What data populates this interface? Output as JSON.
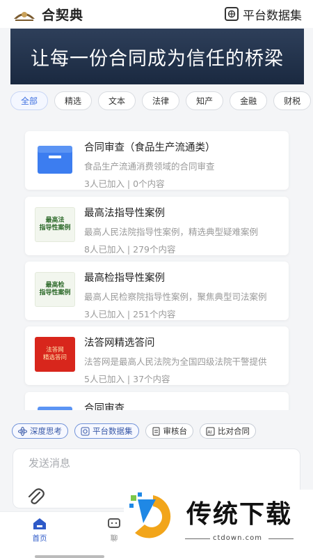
{
  "header": {
    "app_name": "合契典",
    "dataset_label": "平台数据集"
  },
  "banner": {
    "text": "让每一份合同成为信任的桥梁"
  },
  "categories": [
    {
      "label": "全部",
      "active": true
    },
    {
      "label": "精选"
    },
    {
      "label": "文本"
    },
    {
      "label": "法律"
    },
    {
      "label": "知产"
    },
    {
      "label": "金融"
    },
    {
      "label": "财税"
    }
  ],
  "cards": [
    {
      "title": "合同审查（食品生产流通类）",
      "desc": "食品生产流通消费领域的合同审查",
      "meta": "3人已加入 | 0个内容",
      "thumb": "folder-icon"
    },
    {
      "title": "最高法指导性案例",
      "desc": "最高人民法院指导性案例，精选典型疑难案例",
      "meta": "8人已加入 | 279个内容",
      "thumb_text": [
        "最高法",
        "指导性案例"
      ]
    },
    {
      "title": "最高检指导性案例",
      "desc": "最高人民检察院指导性案例，聚焦典型司法案例",
      "meta": "3人已加入 | 251个内容",
      "thumb_text": [
        "最高检",
        "指导性案例"
      ]
    },
    {
      "title": "法答网精选答问",
      "desc": "法答网是最高人民法院为全国四级法院干警提供",
      "meta": "5人已加入 | 37个内容",
      "thumb_text": [
        "法答网",
        "精选答问"
      ]
    },
    {
      "title": "合同审查",
      "desc": "",
      "meta": "",
      "thumb": "folder-icon"
    }
  ],
  "actions": [
    {
      "label": "深度思考",
      "icon": "atom-icon",
      "highlight": true
    },
    {
      "label": "平台数据集",
      "icon": "dataset-icon",
      "highlight": true
    },
    {
      "label": "审核台",
      "icon": "review-icon"
    },
    {
      "label": "比对合同",
      "icon": "ai-compare-icon"
    }
  ],
  "composer": {
    "placeholder": "发送消息"
  },
  "nav": [
    {
      "label": "首页",
      "active": true
    },
    {
      "label": "聊"
    }
  ],
  "watermark": {
    "brand": "传统下载",
    "url": "ctdown.com"
  },
  "colors": {
    "accent": "#2e5ac8",
    "banner": "#1f2f48"
  }
}
